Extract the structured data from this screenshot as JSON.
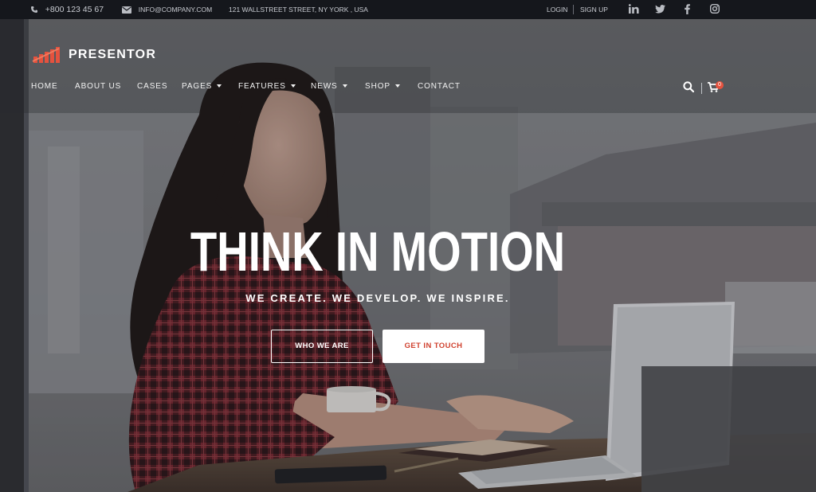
{
  "topbar": {
    "phone": "+800 123 45 67",
    "email": "INFO@COMPANY.COM",
    "address": "121 WALLSTREET STREET, NY YORK , USA",
    "login": "LOGIN",
    "signup": "SIGN UP",
    "social_icons": [
      "linkedin-icon",
      "twitter-icon",
      "facebook-icon",
      "instagram-icon"
    ]
  },
  "brand": {
    "name": "PRESENTOR",
    "accent": "#e5523e"
  },
  "nav": {
    "items": [
      {
        "label": "HOME"
      },
      {
        "label": "ABOUT US"
      },
      {
        "label": "CASES"
      },
      {
        "label": "PAGES",
        "dropdown": true
      },
      {
        "label": "FEATURES",
        "dropdown": true
      },
      {
        "label": "NEWS",
        "dropdown": true
      },
      {
        "label": "SHOP",
        "dropdown": true
      },
      {
        "label": "CONTACT"
      }
    ],
    "cart_count": "0"
  },
  "hero": {
    "headline": "THINK IN MOTION",
    "subline": "WE CREATE. WE DEVELOP. WE INSPIRE.",
    "primary_button": "WHO WE ARE",
    "secondary_button": "GET IN TOUCH",
    "button_text_color": "#d0422f"
  }
}
